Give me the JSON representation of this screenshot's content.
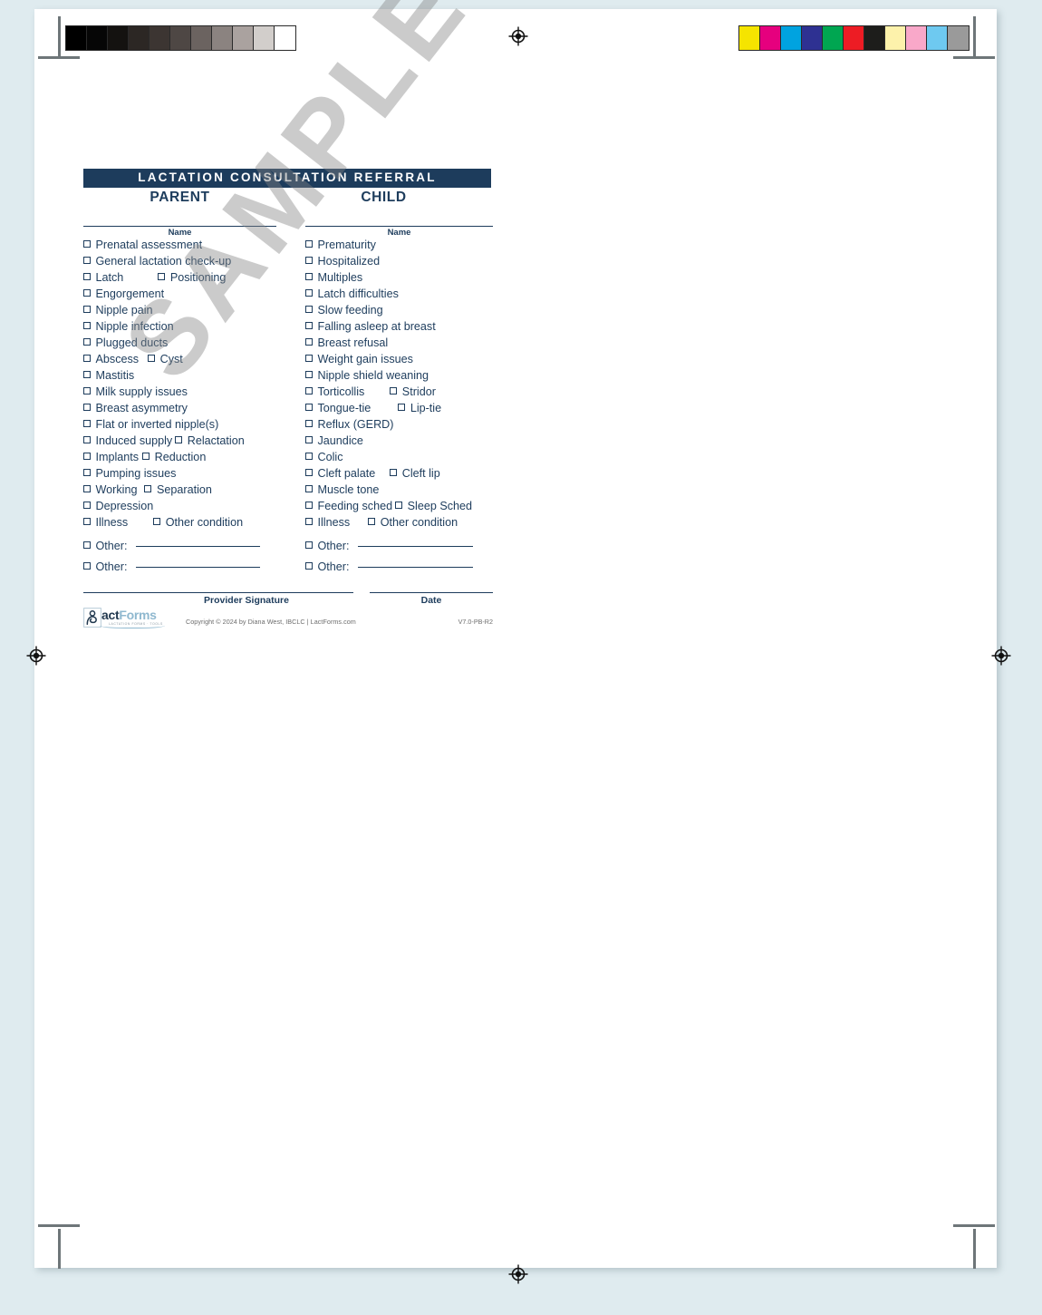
{
  "document": {
    "title": "LACTATION CONSULTATION REFERRAL",
    "watermark": "SAMPLE"
  },
  "columns": {
    "parent": {
      "heading": "PARENT",
      "name_label": "Name",
      "items": [
        {
          "label": "Prenatal assessment"
        },
        {
          "label": "General lactation check-up"
        },
        {
          "label": "Latch",
          "label2": "Positioning",
          "pad": 38
        },
        {
          "label": "Engorgement"
        },
        {
          "label": "Nipple pain"
        },
        {
          "label": "Nipple infection"
        },
        {
          "label": "Plugged ducts"
        },
        {
          "label": "Abscess",
          "label2": "Cyst",
          "pad": 10
        },
        {
          "label": "Mastitis"
        },
        {
          "label": "Milk supply issues"
        },
        {
          "label": "Breast asymmetry"
        },
        {
          "label": "Flat or inverted nipple(s)"
        },
        {
          "label": "Induced supply",
          "label2": "Relactation",
          "pad": 3
        },
        {
          "label": "Implants",
          "label2": "Reduction",
          "pad": 4
        },
        {
          "label": "Pumping issues"
        },
        {
          "label": "Working",
          "label2": "Separation",
          "pad": 8
        },
        {
          "label": "Depression"
        },
        {
          "label": "Illness",
          "label2": "Other condition",
          "pad": 28
        }
      ],
      "other_rows": [
        {
          "label": "Other:",
          "value": ""
        },
        {
          "label": "Other:",
          "value": ""
        }
      ]
    },
    "child": {
      "heading": "CHILD",
      "name_label": "Name",
      "items": [
        {
          "label": "Prematurity"
        },
        {
          "label": "Hospitalized"
        },
        {
          "label": "Multiples"
        },
        {
          "label": "Latch difficulties"
        },
        {
          "label": "Slow feeding"
        },
        {
          "label": "Falling asleep at breast"
        },
        {
          "label": "Breast refusal"
        },
        {
          "label": "Weight gain issues"
        },
        {
          "label": "Nipple shield weaning"
        },
        {
          "label": "Torticollis",
          "label2": "Stridor",
          "pad": 28
        },
        {
          "label": "Tongue-tie",
          "label2": "Lip-tie",
          "pad": 30
        },
        {
          "label": "Reflux (GERD)"
        },
        {
          "label": "Jaundice"
        },
        {
          "label": "Colic"
        },
        {
          "label": "Cleft palate",
          "label2": "Cleft lip",
          "pad": 16
        },
        {
          "label": "Muscle tone"
        },
        {
          "label": "Feeding sched",
          "label2": "Sleep Sched",
          "pad": 3
        },
        {
          "label": "Illness",
          "label2": "Other condition",
          "pad": 20
        }
      ],
      "other_rows": [
        {
          "label": "Other:",
          "value": ""
        },
        {
          "label": "Other:",
          "value": ""
        }
      ]
    }
  },
  "signature": {
    "provider_label": "Provider Signature",
    "date_label": "Date"
  },
  "footer": {
    "logo_text_a": "act",
    "logo_text_b": "Forms",
    "logo_tagline": "LACTATION FORMS · TOOLS",
    "copyright": "Copyright © 2024 by Diana West, IBCLC  |  LactForms.com",
    "version": "V7.0-PB-R2"
  },
  "calibration": {
    "grayscale": [
      "#000000",
      "#060606",
      "#141210",
      "#2c2724",
      "#3c3532",
      "#4e4744",
      "#6b6360",
      "#8b8380",
      "#aaa29f",
      "#d2cecb",
      "#ffffff"
    ],
    "colors": [
      "#f5e400",
      "#e6007e",
      "#00a3e0",
      "#2e3192",
      "#00a651",
      "#ed1c24",
      "#1d1d1b",
      "#fdf2ab",
      "#f9a8c9",
      "#6ec9f0",
      "#9a9a9a"
    ]
  },
  "colors": {
    "navy": "#1d3c5c",
    "page_background": "#dfebef",
    "sheet": "#ffffff"
  }
}
